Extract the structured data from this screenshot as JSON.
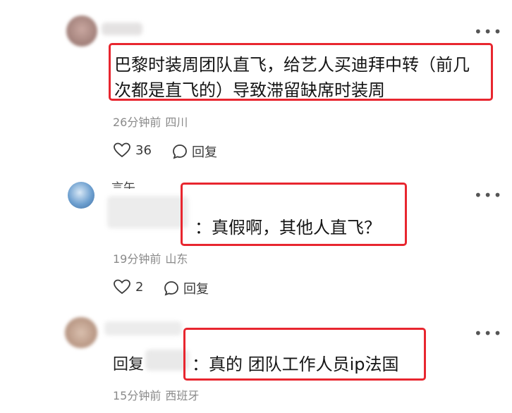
{
  "comments": [
    {
      "text_lines": [
        "巴黎时装周团队直飞，给艺人买迪拜中转（前几",
        "次都是直飞的）导致滞留缺席时装周"
      ],
      "time": "26分钟前",
      "location": "四川",
      "likes": "36",
      "reply_label": "回复"
    },
    {
      "username_partial": "言午",
      "text": "：真假啊，其他人直飞？",
      "time": "19分钟前",
      "location": "山东",
      "likes": "2",
      "reply_label": "回复"
    },
    {
      "reply_prefix": "回复",
      "text": "：真的 团队工作人员ip法国",
      "time": "15分钟前",
      "location": "西班牙"
    }
  ],
  "icons": {
    "more": "more-horizontal-icon",
    "like": "heart-icon",
    "reply": "comment-bubble-icon"
  },
  "colors": {
    "highlight_box": "#e8262f",
    "meta_text": "#8a8a8a"
  }
}
